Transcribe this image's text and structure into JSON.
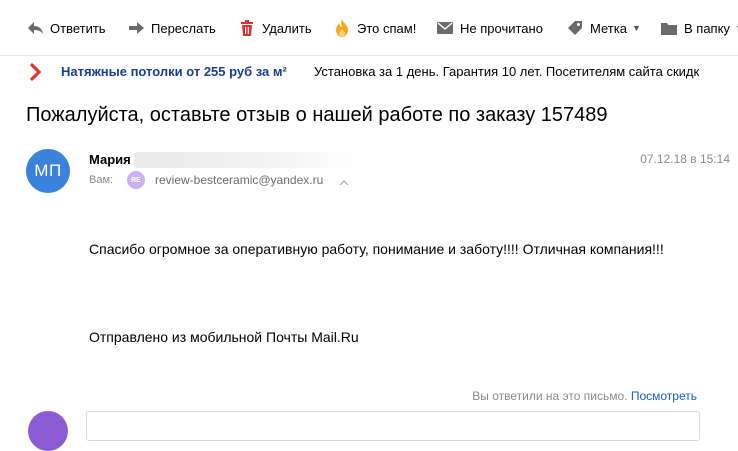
{
  "toolbar": {
    "reply": "Ответить",
    "forward": "Переслать",
    "delete": "Удалить",
    "spam": "Это спам!",
    "unread": "Не прочитано",
    "label": "Метка",
    "folder": "В папку",
    "icons": [
      "reply-arrow",
      "forward-arrow",
      "trash-can",
      "flame",
      "envelope",
      "tag",
      "folder"
    ],
    "colors": {
      "delete": "#e0312f",
      "spam": "#f5a623"
    }
  },
  "promo": {
    "title": "Натяжные потолки от 255 руб за м²",
    "text": "Установка за 1 день. Гарантия 10 лет. Посетителям сайта скидк",
    "icon": "red-circle-arrow",
    "color": "#e0312f"
  },
  "message": {
    "subject": "Пожалуйста, оставьте отзыв о нашей работе по заказу 157489",
    "avatar_initials": "МП",
    "avatar_color": "#3b82dc",
    "sender_name": "Мария",
    "date": "07.12.18 в 15:14",
    "to_label": "Вам:",
    "to_badge": "RE",
    "to_email": "review-bestceramic@yandex.ru",
    "body_line1": "Спасибо огромное за оперативную работу, понимание и заботу!!!! Отличная компания!!!",
    "body_line2": "Отправлено из мобильной Почты Mail.Ru"
  },
  "footer": {
    "replied_text": "Вы ответили на это письмо.",
    "view_link": "Посмотреть"
  }
}
